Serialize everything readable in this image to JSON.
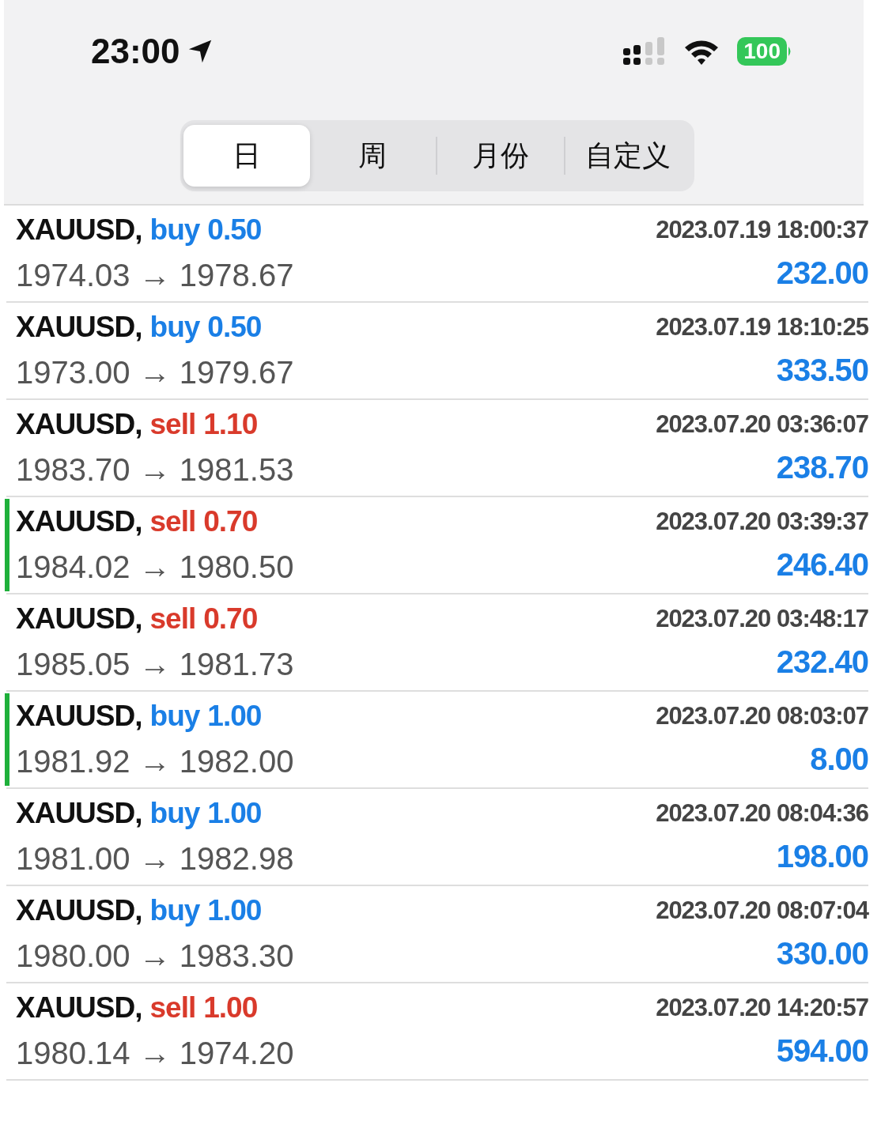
{
  "status_bar": {
    "time": "23:00",
    "battery": "100"
  },
  "tabs": [
    {
      "label": "日",
      "selected": true
    },
    {
      "label": "周",
      "selected": false
    },
    {
      "label": "月份",
      "selected": false
    },
    {
      "label": "自定义",
      "selected": false
    }
  ],
  "trades": [
    {
      "symbol": "XAUUSD,",
      "kind": "buy",
      "side": "buy",
      "volume": "0.50",
      "prices": "1974.03 → 1978.67",
      "time": "2023.07.19 18:00:37",
      "profit": "232.00",
      "marked": false
    },
    {
      "symbol": "XAUUSD,",
      "kind": "buy",
      "side": "buy",
      "volume": "0.50",
      "prices": "1973.00 → 1979.67",
      "time": "2023.07.19 18:10:25",
      "profit": "333.50",
      "marked": false
    },
    {
      "symbol": "XAUUSD,",
      "kind": "sell",
      "side": "sell",
      "volume": "1.10",
      "prices": "1983.70 → 1981.53",
      "time": "2023.07.20 03:36:07",
      "profit": "238.70",
      "marked": false
    },
    {
      "symbol": "XAUUSD,",
      "kind": "sell",
      "side": "sell",
      "volume": "0.70",
      "prices": "1984.02 → 1980.50",
      "time": "2023.07.20 03:39:37",
      "profit": "246.40",
      "marked": true
    },
    {
      "symbol": "XAUUSD,",
      "kind": "sell",
      "side": "sell",
      "volume": "0.70",
      "prices": "1985.05 → 1981.73",
      "time": "2023.07.20 03:48:17",
      "profit": "232.40",
      "marked": false
    },
    {
      "symbol": "XAUUSD,",
      "kind": "buy",
      "side": "buy",
      "volume": "1.00",
      "prices": "1981.92 → 1982.00",
      "time": "2023.07.20 08:03:07",
      "profit": "8.00",
      "marked": true
    },
    {
      "symbol": "XAUUSD,",
      "kind": "buy",
      "side": "buy",
      "volume": "1.00",
      "prices": "1981.00 → 1982.98",
      "time": "2023.07.20 08:04:36",
      "profit": "198.00",
      "marked": false
    },
    {
      "symbol": "XAUUSD,",
      "kind": "buy",
      "side": "buy",
      "volume": "1.00",
      "prices": "1980.00 → 1983.30",
      "time": "2023.07.20 08:07:04",
      "profit": "330.00",
      "marked": false
    },
    {
      "symbol": "XAUUSD,",
      "kind": "sell",
      "side": "sell",
      "volume": "1.00",
      "prices": "1980.14 → 1974.20",
      "time": "2023.07.20 14:20:57",
      "profit": "594.00",
      "marked": false
    }
  ]
}
